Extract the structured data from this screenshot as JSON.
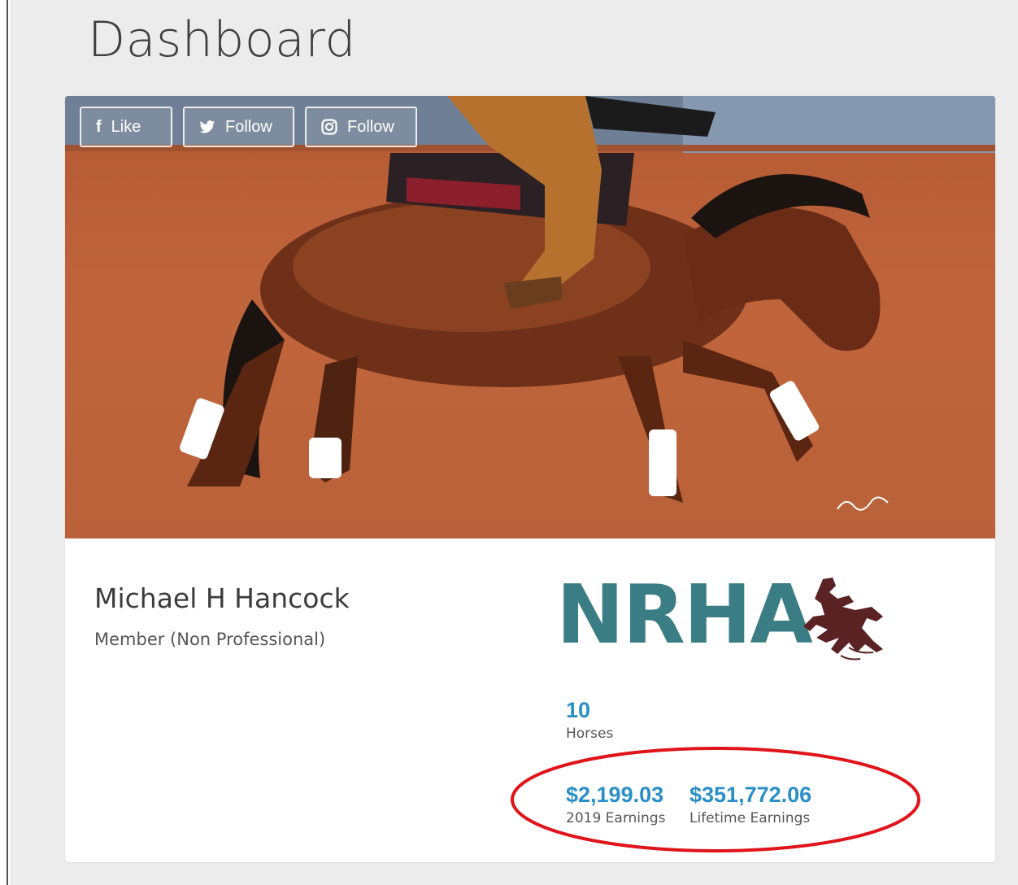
{
  "page": {
    "title": "Dashboard"
  },
  "social": {
    "like": {
      "icon": "facebook-icon",
      "label": "Like"
    },
    "twitter": {
      "icon": "twitter-icon",
      "label": "Follow"
    },
    "instagram": {
      "icon": "instagram-icon",
      "label": "Follow"
    }
  },
  "profile": {
    "name": "Michael H Hancock",
    "membership": "Member (Non Professional)"
  },
  "logo": {
    "text": "NRHA",
    "colors": {
      "text": "#3a7d84",
      "rider": "#5a2222"
    }
  },
  "stats": {
    "horses": {
      "value": "10",
      "label": "Horses"
    },
    "earnings_2019": {
      "value": "$2,199.03",
      "label": "2019 Earnings"
    },
    "lifetime_earnings": {
      "value": "$351,772.06",
      "label": "Lifetime Earnings"
    }
  },
  "colors": {
    "accent": "#2b8fc7",
    "annotation": "#e0141a",
    "background": "#ececec"
  }
}
